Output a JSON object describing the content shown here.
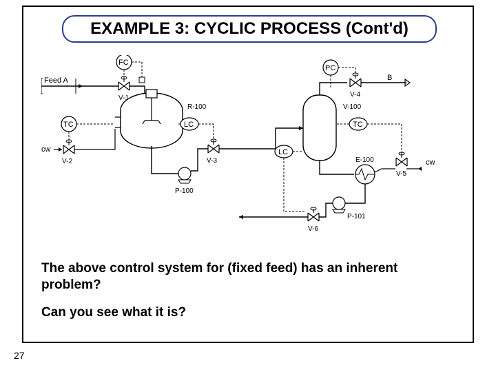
{
  "title": "EXAMPLE 3: CYCLIC PROCESS (Cont'd)",
  "question1": "The above control system for (fixed feed) has an inherent problem?",
  "question2": "Can you see what it is?",
  "page_number": "27",
  "diagram": {
    "left": {
      "feed_label": "Feed A",
      "fc": "FC",
      "tc": "TC",
      "lc": "LC",
      "cw": "cw",
      "v1": "V-1",
      "v2": "V-2",
      "v3": "V-3",
      "reactor": "R-100",
      "pump": "P-100"
    },
    "right": {
      "pc": "PC",
      "tc": "TC",
      "lc": "LC",
      "b_label": "B",
      "cw": "cw",
      "v4": "V-4",
      "v5": "V-5",
      "v6": "V-6",
      "vessel": "V-100",
      "exchanger": "E-100",
      "pump": "P-101"
    }
  }
}
